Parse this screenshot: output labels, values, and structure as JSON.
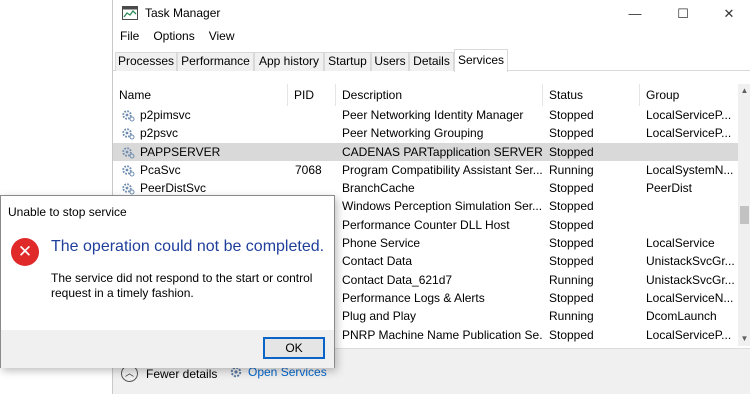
{
  "window": {
    "title": "Task Manager",
    "minimize_glyph": "—",
    "maximize_glyph": "☐",
    "close_glyph": "✕"
  },
  "menu": [
    "File",
    "Options",
    "View"
  ],
  "tabs": [
    "Processes",
    "Performance",
    "App history",
    "Startup",
    "Users",
    "Details",
    "Services"
  ],
  "active_tab": "Services",
  "columns": {
    "name": "Name",
    "pid": "PID",
    "description": "Description",
    "status": "Status",
    "group": "Group"
  },
  "rows": [
    {
      "name": "p2pimsvc",
      "pid": "",
      "description": "Peer Networking Identity Manager",
      "status": "Stopped",
      "group": "LocalServiceP..."
    },
    {
      "name": "p2psvc",
      "pid": "",
      "description": "Peer Networking Grouping",
      "status": "Stopped",
      "group": "LocalServiceP..."
    },
    {
      "name": "PAPPSERVER",
      "pid": "",
      "description": "CADENAS PARTapplication SERVER V...",
      "status": "Stopped",
      "group": ""
    },
    {
      "name": "PcaSvc",
      "pid": "7068",
      "description": "Program Compatibility Assistant Ser...",
      "status": "Running",
      "group": "LocalSystemN..."
    },
    {
      "name": "PeerDistSvc",
      "pid": "",
      "description": "BranchCache",
      "status": "Stopped",
      "group": "PeerDist"
    },
    {
      "name": "",
      "pid": "",
      "description": "Windows Perception Simulation Ser...",
      "status": "Stopped",
      "group": ""
    },
    {
      "name": "",
      "pid": "",
      "description": "Performance Counter DLL Host",
      "status": "Stopped",
      "group": ""
    },
    {
      "name": "",
      "pid": "",
      "description": "Phone Service",
      "status": "Stopped",
      "group": "LocalService"
    },
    {
      "name": "",
      "pid": "",
      "description": "Contact Data",
      "status": "Stopped",
      "group": "UnistackSvcGr..."
    },
    {
      "name": "",
      "pid": "",
      "description": "Contact Data_621d7",
      "status": "Running",
      "group": "UnistackSvcGr..."
    },
    {
      "name": "",
      "pid": "",
      "description": "Performance Logs & Alerts",
      "status": "Stopped",
      "group": "LocalServiceN..."
    },
    {
      "name": "",
      "pid": "",
      "description": "Plug and Play",
      "status": "Running",
      "group": "DcomLaunch"
    },
    {
      "name": "",
      "pid": "",
      "description": "PNRP Machine Name Publication Se...",
      "status": "Stopped",
      "group": "LocalServiceP..."
    }
  ],
  "selected_row": 2,
  "footer": {
    "fewer_details": "Fewer details",
    "open_services": "Open Services"
  },
  "dialog": {
    "title": "Unable to stop service",
    "heading": "The operation could not be completed.",
    "body": "The service did not respond to the start or control request in a timely fashion.",
    "ok_label": "OK",
    "error_glyph": "✕"
  },
  "colors": {
    "accent": "#0a64c8",
    "heading": "#1f3f9b",
    "error": "#e02a2a",
    "selected_row": "#d9d9d9",
    "link": "#0066cc"
  }
}
